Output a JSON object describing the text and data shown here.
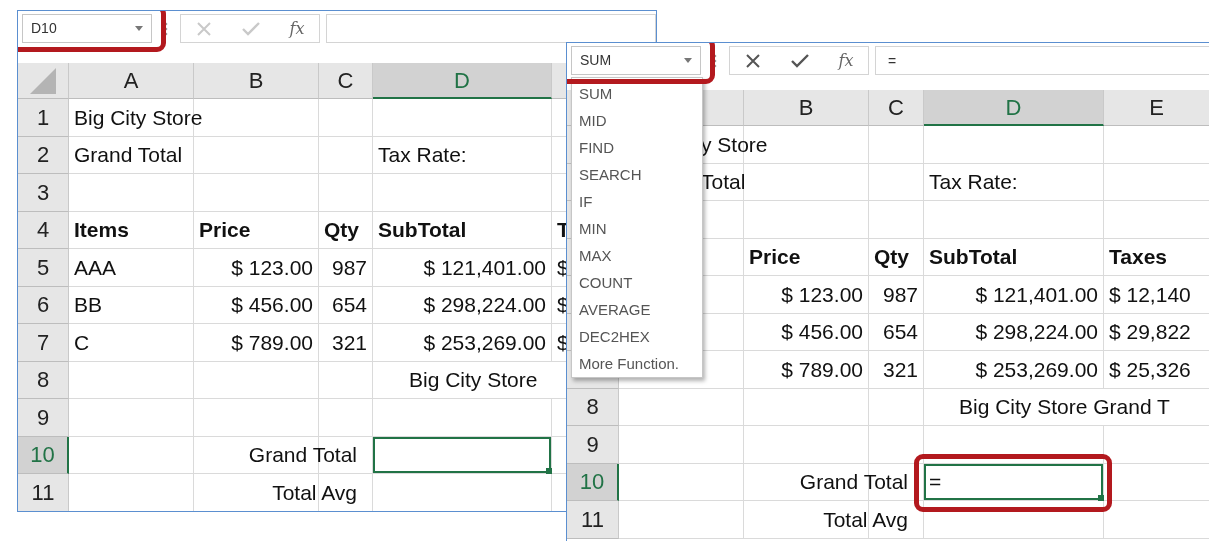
{
  "windows": [
    {
      "name_box": {
        "value": "D10",
        "highlighted": true
      },
      "formula_bar": {
        "editing": false,
        "fx": "fx"
      },
      "columns": [
        {
          "label": "A",
          "selected": false
        },
        {
          "label": "B",
          "selected": false
        },
        {
          "label": "C",
          "selected": false
        },
        {
          "label": "D",
          "selected": true
        },
        {
          "selected": false
        }
      ],
      "rows": [
        {
          "label": "1",
          "selected": false,
          "cells": [
            {
              "text": "Big City Store",
              "kind": "text"
            }
          ]
        },
        {
          "label": "2",
          "selected": false,
          "cells": [
            {
              "text": "Grand Total",
              "kind": "text"
            },
            null,
            null,
            {
              "text": "Tax Rate:",
              "kind": "text"
            }
          ]
        },
        {
          "label": "3",
          "selected": false,
          "cells": []
        },
        {
          "label": "4",
          "selected": false,
          "cells": [
            {
              "text": "Items",
              "kind": "heading"
            },
            {
              "text": "Price",
              "kind": "heading"
            },
            {
              "text": "Qty",
              "kind": "heading"
            },
            {
              "text": "SubTotal",
              "kind": "heading"
            },
            {
              "text": "T",
              "kind": "heading"
            }
          ]
        },
        {
          "label": "5",
          "selected": false,
          "cells": [
            {
              "text": "AAA",
              "kind": "text"
            },
            {
              "text": "$ 123.00",
              "kind": "amount"
            },
            {
              "text": "987",
              "kind": "amount"
            },
            {
              "text": "$ 121,401.00",
              "kind": "amount"
            },
            {
              "text": "$",
              "kind": "text"
            }
          ]
        },
        {
          "label": "6",
          "selected": false,
          "cells": [
            {
              "text": "BB",
              "kind": "text"
            },
            {
              "text": "$ 456.00",
              "kind": "amount"
            },
            {
              "text": "654",
              "kind": "amount"
            },
            {
              "text": "$ 298,224.00",
              "kind": "amount"
            },
            {
              "text": "$",
              "kind": "text"
            }
          ]
        },
        {
          "label": "7",
          "selected": false,
          "cells": [
            {
              "text": "C",
              "kind": "text"
            },
            {
              "text": "$ 789.00",
              "kind": "amount"
            },
            {
              "text": "321",
              "kind": "amount"
            },
            {
              "text": "$ 253,269.00",
              "kind": "amount"
            },
            {
              "text": "$",
              "kind": "text"
            }
          ]
        },
        {
          "label": "8",
          "selected": false,
          "cells": [
            null,
            null,
            null,
            {
              "text": "Big City Store",
              "kind": "banner"
            }
          ]
        },
        {
          "label": "9",
          "selected": false,
          "cells": []
        },
        {
          "label": "10",
          "selected": true,
          "cells": [
            null,
            null,
            {
              "text": "Grand Total",
              "kind": "label"
            },
            {
              "selected": true
            }
          ]
        },
        {
          "label": "11",
          "selected": false,
          "cells": [
            null,
            null,
            {
              "text": "Total Avg",
              "kind": "label"
            }
          ]
        }
      ]
    },
    {
      "name_box": {
        "value": "SUM",
        "highlighted": true
      },
      "formula_bar": {
        "editing": true,
        "fx": "fx",
        "value": "="
      },
      "dropdown": {
        "items": [
          "SUM",
          "MID",
          "FIND",
          "SEARCH",
          "IF",
          "MIN",
          "MAX",
          "COUNT",
          "AVERAGE",
          "DEC2HEX",
          "More Function."
        ]
      },
      "columns": [
        {
          "selected": false
        },
        {
          "label": "B",
          "selected": false
        },
        {
          "label": "C",
          "selected": false
        },
        {
          "label": "D",
          "selected": true
        },
        {
          "label": "E",
          "selected": false
        }
      ],
      "rows": [
        {
          "selected": false,
          "cells": [
            {
              "text": "y Store",
              "kind": "partial"
            }
          ]
        },
        {
          "selected": false,
          "cells": [
            {
              "text": "Total",
              "kind": "partial"
            },
            null,
            null,
            {
              "text": "Tax Rate:",
              "kind": "text"
            }
          ]
        },
        {
          "selected": false,
          "cells": []
        },
        {
          "selected": false,
          "cells": [
            null,
            {
              "text": "Price",
              "kind": "heading"
            },
            {
              "text": "Qty",
              "kind": "heading"
            },
            {
              "text": "SubTotal",
              "kind": "heading"
            },
            {
              "text": "Taxes",
              "kind": "heading"
            }
          ]
        },
        {
          "selected": false,
          "cells": [
            null,
            {
              "text": "$ 123.00",
              "kind": "amount"
            },
            {
              "text": "987",
              "kind": "amount"
            },
            {
              "text": "$ 121,401.00",
              "kind": "amount"
            },
            {
              "text": "$ 12,140",
              "kind": "text"
            }
          ]
        },
        {
          "selected": false,
          "cells": [
            null,
            {
              "text": "$ 456.00",
              "kind": "amount"
            },
            {
              "text": "654",
              "kind": "amount"
            },
            {
              "text": "$ 298,224.00",
              "kind": "amount"
            },
            {
              "text": "$ 29,822",
              "kind": "text"
            }
          ]
        },
        {
          "selected": false,
          "cells": [
            null,
            {
              "text": "$ 789.00",
              "kind": "amount"
            },
            {
              "text": "321",
              "kind": "amount"
            },
            {
              "text": "$ 253,269.00",
              "kind": "amount"
            },
            {
              "text": "$ 25,326",
              "kind": "text"
            }
          ]
        },
        {
          "label": "8",
          "selected": false,
          "cells": [
            null,
            null,
            null,
            {
              "text": "Big City Store Grand T",
              "kind": "banner"
            }
          ]
        },
        {
          "label": "9",
          "selected": false,
          "cells": []
        },
        {
          "label": "10",
          "selected": true,
          "cells": [
            null,
            null,
            {
              "text": "Grand Total",
              "kind": "label"
            },
            {
              "text": "=",
              "selected": true,
              "highlighted": true
            }
          ]
        },
        {
          "label": "11",
          "selected": false,
          "cells": [
            null,
            null,
            {
              "text": "Total Avg",
              "kind": "label"
            }
          ]
        }
      ]
    }
  ]
}
